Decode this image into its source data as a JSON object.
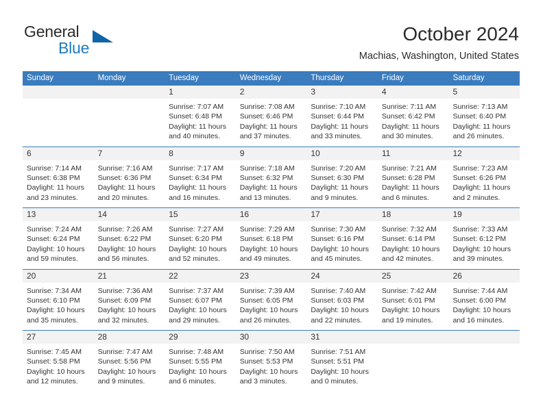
{
  "brand": {
    "name_top": "General",
    "name_bottom": "Blue",
    "triangle_color": "#1164a8",
    "blue_color": "#1f7bc1"
  },
  "header": {
    "title": "October 2024",
    "location": "Machias, Washington, United States"
  },
  "theme": {
    "header_blue": "#3a7cbe",
    "day_strip_gray": "#f2f2f2",
    "text": "#333333"
  },
  "weekdays": [
    "Sunday",
    "Monday",
    "Tuesday",
    "Wednesday",
    "Thursday",
    "Friday",
    "Saturday"
  ],
  "weeks": [
    {
      "days": [
        {
          "num": "",
          "lines": [
            "",
            "",
            "",
            ""
          ]
        },
        {
          "num": "",
          "lines": [
            "",
            "",
            "",
            ""
          ]
        },
        {
          "num": "1",
          "lines": [
            "Sunrise: 7:07 AM",
            "Sunset: 6:48 PM",
            "Daylight: 11 hours",
            "and 40 minutes."
          ]
        },
        {
          "num": "2",
          "lines": [
            "Sunrise: 7:08 AM",
            "Sunset: 6:46 PM",
            "Daylight: 11 hours",
            "and 37 minutes."
          ]
        },
        {
          "num": "3",
          "lines": [
            "Sunrise: 7:10 AM",
            "Sunset: 6:44 PM",
            "Daylight: 11 hours",
            "and 33 minutes."
          ]
        },
        {
          "num": "4",
          "lines": [
            "Sunrise: 7:11 AM",
            "Sunset: 6:42 PM",
            "Daylight: 11 hours",
            "and 30 minutes."
          ]
        },
        {
          "num": "5",
          "lines": [
            "Sunrise: 7:13 AM",
            "Sunset: 6:40 PM",
            "Daylight: 11 hours",
            "and 26 minutes."
          ]
        }
      ]
    },
    {
      "days": [
        {
          "num": "6",
          "lines": [
            "Sunrise: 7:14 AM",
            "Sunset: 6:38 PM",
            "Daylight: 11 hours",
            "and 23 minutes."
          ]
        },
        {
          "num": "7",
          "lines": [
            "Sunrise: 7:16 AM",
            "Sunset: 6:36 PM",
            "Daylight: 11 hours",
            "and 20 minutes."
          ]
        },
        {
          "num": "8",
          "lines": [
            "Sunrise: 7:17 AM",
            "Sunset: 6:34 PM",
            "Daylight: 11 hours",
            "and 16 minutes."
          ]
        },
        {
          "num": "9",
          "lines": [
            "Sunrise: 7:18 AM",
            "Sunset: 6:32 PM",
            "Daylight: 11 hours",
            "and 13 minutes."
          ]
        },
        {
          "num": "10",
          "lines": [
            "Sunrise: 7:20 AM",
            "Sunset: 6:30 PM",
            "Daylight: 11 hours",
            "and 9 minutes."
          ]
        },
        {
          "num": "11",
          "lines": [
            "Sunrise: 7:21 AM",
            "Sunset: 6:28 PM",
            "Daylight: 11 hours",
            "and 6 minutes."
          ]
        },
        {
          "num": "12",
          "lines": [
            "Sunrise: 7:23 AM",
            "Sunset: 6:26 PM",
            "Daylight: 11 hours",
            "and 2 minutes."
          ]
        }
      ]
    },
    {
      "days": [
        {
          "num": "13",
          "lines": [
            "Sunrise: 7:24 AM",
            "Sunset: 6:24 PM",
            "Daylight: 10 hours",
            "and 59 minutes."
          ]
        },
        {
          "num": "14",
          "lines": [
            "Sunrise: 7:26 AM",
            "Sunset: 6:22 PM",
            "Daylight: 10 hours",
            "and 56 minutes."
          ]
        },
        {
          "num": "15",
          "lines": [
            "Sunrise: 7:27 AM",
            "Sunset: 6:20 PM",
            "Daylight: 10 hours",
            "and 52 minutes."
          ]
        },
        {
          "num": "16",
          "lines": [
            "Sunrise: 7:29 AM",
            "Sunset: 6:18 PM",
            "Daylight: 10 hours",
            "and 49 minutes."
          ]
        },
        {
          "num": "17",
          "lines": [
            "Sunrise: 7:30 AM",
            "Sunset: 6:16 PM",
            "Daylight: 10 hours",
            "and 45 minutes."
          ]
        },
        {
          "num": "18",
          "lines": [
            "Sunrise: 7:32 AM",
            "Sunset: 6:14 PM",
            "Daylight: 10 hours",
            "and 42 minutes."
          ]
        },
        {
          "num": "19",
          "lines": [
            "Sunrise: 7:33 AM",
            "Sunset: 6:12 PM",
            "Daylight: 10 hours",
            "and 39 minutes."
          ]
        }
      ]
    },
    {
      "days": [
        {
          "num": "20",
          "lines": [
            "Sunrise: 7:34 AM",
            "Sunset: 6:10 PM",
            "Daylight: 10 hours",
            "and 35 minutes."
          ]
        },
        {
          "num": "21",
          "lines": [
            "Sunrise: 7:36 AM",
            "Sunset: 6:09 PM",
            "Daylight: 10 hours",
            "and 32 minutes."
          ]
        },
        {
          "num": "22",
          "lines": [
            "Sunrise: 7:37 AM",
            "Sunset: 6:07 PM",
            "Daylight: 10 hours",
            "and 29 minutes."
          ]
        },
        {
          "num": "23",
          "lines": [
            "Sunrise: 7:39 AM",
            "Sunset: 6:05 PM",
            "Daylight: 10 hours",
            "and 26 minutes."
          ]
        },
        {
          "num": "24",
          "lines": [
            "Sunrise: 7:40 AM",
            "Sunset: 6:03 PM",
            "Daylight: 10 hours",
            "and 22 minutes."
          ]
        },
        {
          "num": "25",
          "lines": [
            "Sunrise: 7:42 AM",
            "Sunset: 6:01 PM",
            "Daylight: 10 hours",
            "and 19 minutes."
          ]
        },
        {
          "num": "26",
          "lines": [
            "Sunrise: 7:44 AM",
            "Sunset: 6:00 PM",
            "Daylight: 10 hours",
            "and 16 minutes."
          ]
        }
      ]
    },
    {
      "days": [
        {
          "num": "27",
          "lines": [
            "Sunrise: 7:45 AM",
            "Sunset: 5:58 PM",
            "Daylight: 10 hours",
            "and 12 minutes."
          ]
        },
        {
          "num": "28",
          "lines": [
            "Sunrise: 7:47 AM",
            "Sunset: 5:56 PM",
            "Daylight: 10 hours",
            "and 9 minutes."
          ]
        },
        {
          "num": "29",
          "lines": [
            "Sunrise: 7:48 AM",
            "Sunset: 5:55 PM",
            "Daylight: 10 hours",
            "and 6 minutes."
          ]
        },
        {
          "num": "30",
          "lines": [
            "Sunrise: 7:50 AM",
            "Sunset: 5:53 PM",
            "Daylight: 10 hours",
            "and 3 minutes."
          ]
        },
        {
          "num": "31",
          "lines": [
            "Sunrise: 7:51 AM",
            "Sunset: 5:51 PM",
            "Daylight: 10 hours",
            "and 0 minutes."
          ]
        },
        {
          "num": "",
          "lines": [
            "",
            "",
            "",
            ""
          ]
        },
        {
          "num": "",
          "lines": [
            "",
            "",
            "",
            ""
          ]
        }
      ]
    }
  ]
}
